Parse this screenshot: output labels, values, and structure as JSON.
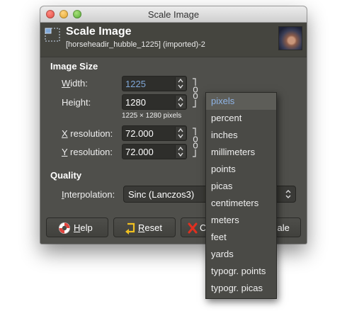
{
  "window": {
    "title": "Scale Image"
  },
  "header": {
    "title": "Scale Image",
    "subtitle": "[horseheadir_hubble_1225] (imported)-2",
    "layer_icon": "scale-layer-icon",
    "thumbnail": "image-thumbnail"
  },
  "image_size": {
    "section_label": "Image Size",
    "width_label": "Width:",
    "width_mnemonic": "W",
    "width_rest": "idth:",
    "width_value": "1225",
    "height_label": "Height:",
    "height_pre": "Hei",
    "height_mnemonic": "g",
    "height_rest": "ht:",
    "height_value": "1280",
    "size_info": "1225 × 1280 pixels",
    "xres_label": "X resolution:",
    "xres_mnemonic": "X",
    "xres_rest": " resolution:",
    "xres_value": "72.000",
    "yres_label": "Y resolution:",
    "yres_mnemonic": "Y",
    "yres_rest": " resolution:",
    "yres_value": "72.000"
  },
  "quality": {
    "section_label": "Quality",
    "interp_label": "Interpolation:",
    "interp_mnemonic": "I",
    "interp_rest": "nterpolation:",
    "interp_value": "Sinc (Lanczos3)"
  },
  "buttons": {
    "help_label": "Help",
    "help_mnemonic": "H",
    "help_rest": "elp",
    "reset_label": "Reset",
    "reset_mnemonic": "R",
    "reset_rest": "eset",
    "cancel_partial": "C",
    "scale_partial": "cale"
  },
  "units_menu": {
    "selected": "pixels",
    "items": [
      "pixels",
      "percent",
      "inches",
      "millimeters",
      "points",
      "picas",
      "centimeters",
      "meters",
      "feet",
      "yards",
      "typogr. points",
      "typogr. picas"
    ]
  },
  "colors": {
    "dialog_bg": "#4f4f4b",
    "header_bg": "#45453f",
    "selection_text": "#8fb4e6",
    "help_icon": "#e0443e",
    "reset_icon": "#f0c020",
    "cancel_icon": "#e03020"
  }
}
